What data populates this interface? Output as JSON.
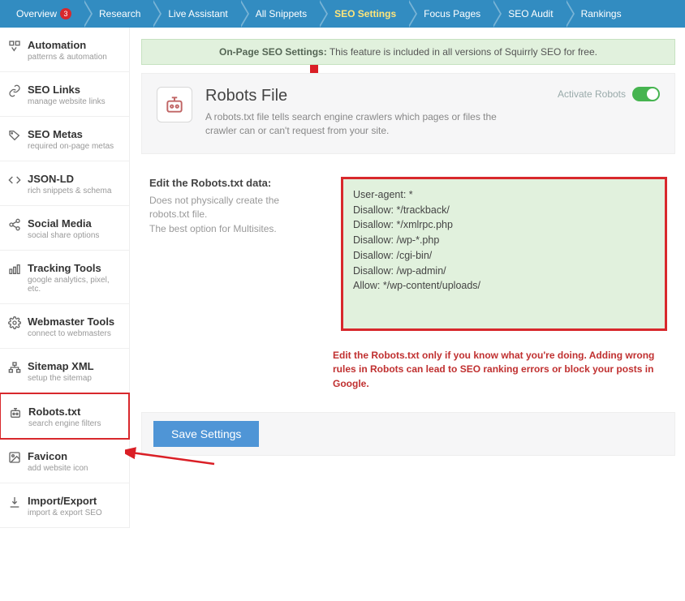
{
  "topnav": {
    "items": [
      {
        "label": "Overview",
        "badge": "3"
      },
      {
        "label": "Research"
      },
      {
        "label": "Live Assistant"
      },
      {
        "label": "All Snippets"
      },
      {
        "label": "SEO Settings",
        "active": true
      },
      {
        "label": "Focus Pages"
      },
      {
        "label": "SEO Audit"
      },
      {
        "label": "Rankings"
      }
    ]
  },
  "sidebar": {
    "items": [
      {
        "title": "Automation",
        "sub": "patterns & automation"
      },
      {
        "title": "SEO Links",
        "sub": "manage website links"
      },
      {
        "title": "SEO Metas",
        "sub": "required on-page metas"
      },
      {
        "title": "JSON-LD",
        "sub": "rich snippets & schema"
      },
      {
        "title": "Social Media",
        "sub": "social share options"
      },
      {
        "title": "Tracking Tools",
        "sub": "google analytics, pixel, etc."
      },
      {
        "title": "Webmaster Tools",
        "sub": "connect to webmasters"
      },
      {
        "title": "Sitemap XML",
        "sub": "setup the sitemap"
      },
      {
        "title": "Robots.txt",
        "sub": "search engine filters",
        "selected": true
      },
      {
        "title": "Favicon",
        "sub": "add website icon"
      },
      {
        "title": "Import/Export",
        "sub": "import & export SEO"
      }
    ]
  },
  "notice": {
    "bold": "On-Page SEO Settings:",
    "text": "This feature is included in all versions of Squirrly SEO for free."
  },
  "card": {
    "title": "Robots File",
    "desc": "A robots.txt file tells search engine crawlers which pages or files the crawler can or can't request from your site.",
    "activate_label": "Activate Robots"
  },
  "editor": {
    "heading": "Edit the Robots.txt data:",
    "help1": "Does not physically create the robots.txt file.",
    "help2": "The best option for Multisites.",
    "content": "User-agent: *\nDisallow: */trackback/\nDisallow: */xmlrpc.php\nDisallow: /wp-*.php\nDisallow: /cgi-bin/\nDisallow: /wp-admin/\nAllow: */wp-content/uploads/",
    "warning": "Edit the Robots.txt only if you know what you're doing. Adding wrong rules in Robots can lead to SEO ranking errors or block your posts in Google."
  },
  "buttons": {
    "save": "Save Settings"
  }
}
